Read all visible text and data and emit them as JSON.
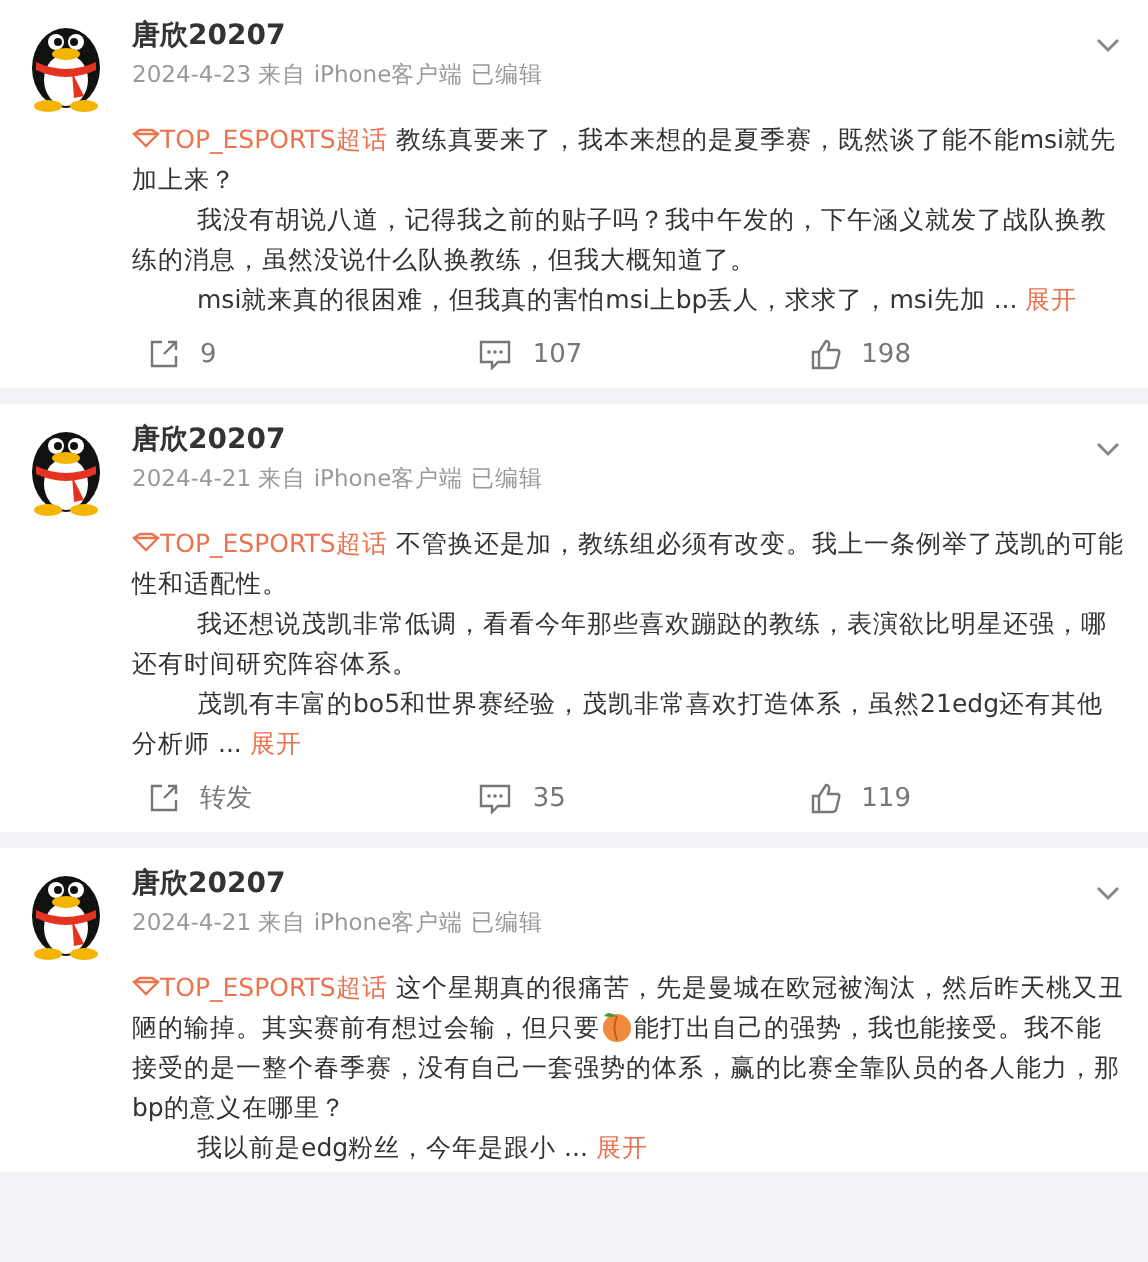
{
  "posts": [
    {
      "username": "唐欣20207",
      "meta": "2024-4-23 来自 iPhone客户端 已编辑",
      "topic": "TOP_ESPORTS超话",
      "paragraphs": [
        [
          "教练真要来了，我本来想的是夏季赛，既然谈了能不能msi就先加上来？"
        ],
        [
          "我没有胡说八道，记得我之前的贴子吗？我中午发的，下午涵义就发了战队换教练的消息，虽然没说什么队换教练，但我大概知道了。"
        ],
        [
          "msi就来真的很困难，但我真的害怕msi上bp丢人，求求了，msi先加"
        ]
      ],
      "ellipsis": "...",
      "expand": "展开",
      "actions": [
        "9",
        "107",
        "198"
      ]
    },
    {
      "username": "唐欣20207",
      "meta": "2024-4-21 来自 iPhone客户端 已编辑",
      "topic": "TOP_ESPORTS超话",
      "paragraphs": [
        [
          "不管换还是加，教练组必须有改变。我上一条例举了茂凯的可能性和适配性。"
        ],
        [
          "我还想说茂凯非常低调，看看今年那些喜欢蹦跶的教练，表演欲比明星还强，哪还有时间研究阵容体系。"
        ],
        [
          "茂凯有丰富的bo5和世界赛经验，茂凯非常喜欢打造体系，虽然21edg还有其他分析师"
        ]
      ],
      "ellipsis": "...",
      "expand": "展开",
      "actions": [
        "转发",
        "35",
        "119"
      ]
    },
    {
      "username": "唐欣20207",
      "meta": "2024-4-21 来自 iPhone客户端 已编辑",
      "topic": "TOP_ESPORTS超话",
      "paragraphs": [
        [
          "这个星期真的很痛苦，先是曼城在欧冠被淘汰，然后昨天桃又丑陋的输掉。其实赛前有想过会输，但只要",
          {
            "kind": "emoji"
          },
          "能打出自己的强势，我也能接受。我不能接受的是一整个春季赛，没有自己一套强势的体系，赢的比赛全靠队员的各人能力，那bp的意义在哪里？"
        ],
        [
          "我以前是edg粉丝，今年是跟小"
        ]
      ],
      "ellipsis": "...",
      "expand": "展开"
    }
  ]
}
